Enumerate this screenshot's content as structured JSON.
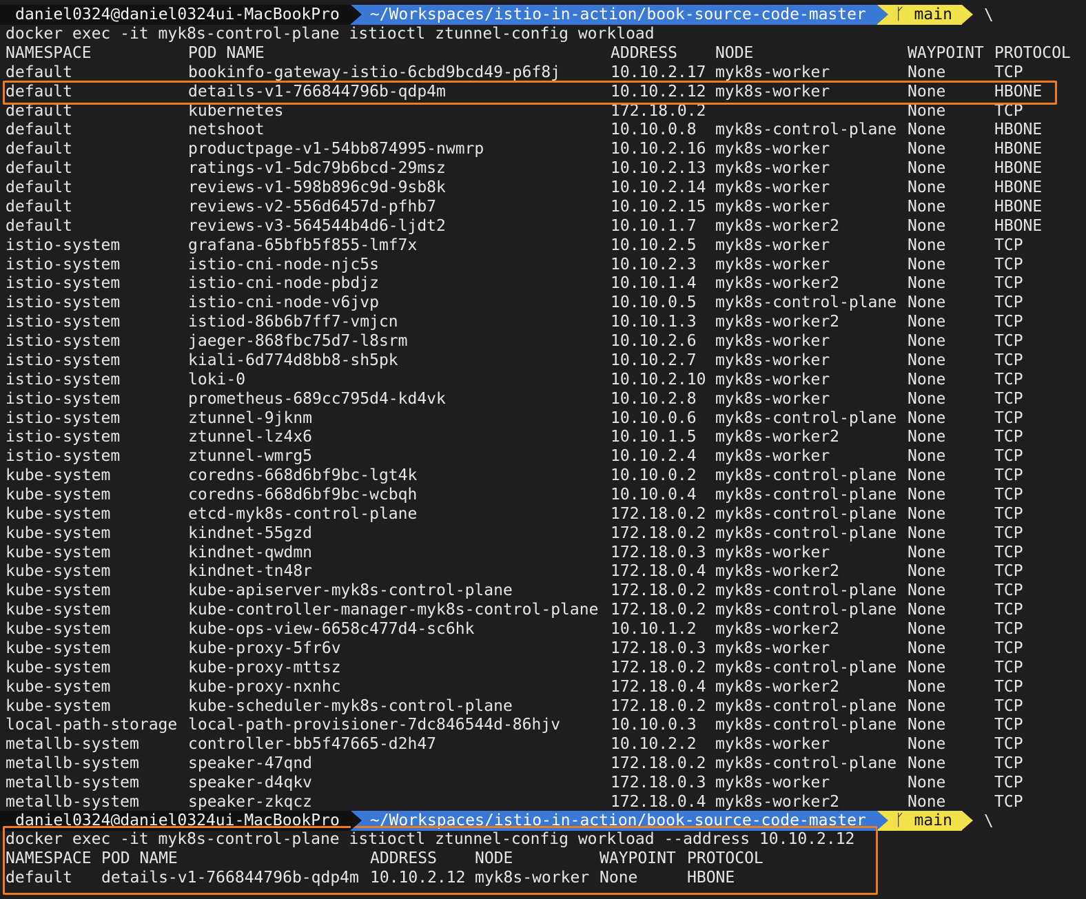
{
  "prompt1": {
    "user": "daniel0324@daniel0324ui-MacBookPro",
    "path": "~/Workspaces/istio-in-action/book-source-code-master",
    "branch_icon": "branch-icon",
    "branch": "main",
    "continuation": "\\"
  },
  "command1": "docker exec -it myk8s-control-plane istioctl ztunnel-config workload",
  "table1": {
    "headers": [
      "NAMESPACE",
      "POD NAME",
      "ADDRESS",
      "NODE",
      "WAYPOINT",
      "PROTOCOL"
    ],
    "rows": [
      [
        "default",
        "bookinfo-gateway-istio-6cbd9bcd49-p6f8j",
        "10.10.2.17",
        "myk8s-worker",
        "None",
        "TCP"
      ],
      [
        "default",
        "details-v1-766844796b-qdp4m",
        "10.10.2.12",
        "myk8s-worker",
        "None",
        "HBONE"
      ],
      [
        "default",
        "kubernetes",
        "172.18.0.2",
        "",
        "None",
        "TCP"
      ],
      [
        "default",
        "netshoot",
        "10.10.0.8",
        "myk8s-control-plane",
        "None",
        "HBONE"
      ],
      [
        "default",
        "productpage-v1-54bb874995-nwmrp",
        "10.10.2.16",
        "myk8s-worker",
        "None",
        "HBONE"
      ],
      [
        "default",
        "ratings-v1-5dc79b6bcd-29msz",
        "10.10.2.13",
        "myk8s-worker",
        "None",
        "HBONE"
      ],
      [
        "default",
        "reviews-v1-598b896c9d-9sb8k",
        "10.10.2.14",
        "myk8s-worker",
        "None",
        "HBONE"
      ],
      [
        "default",
        "reviews-v2-556d6457d-pfhb7",
        "10.10.2.15",
        "myk8s-worker",
        "None",
        "HBONE"
      ],
      [
        "default",
        "reviews-v3-564544b4d6-ljdt2",
        "10.10.1.7",
        "myk8s-worker2",
        "None",
        "HBONE"
      ],
      [
        "istio-system",
        "grafana-65bfb5f855-lmf7x",
        "10.10.2.5",
        "myk8s-worker",
        "None",
        "TCP"
      ],
      [
        "istio-system",
        "istio-cni-node-njc5s",
        "10.10.2.3",
        "myk8s-worker",
        "None",
        "TCP"
      ],
      [
        "istio-system",
        "istio-cni-node-pbdjz",
        "10.10.1.4",
        "myk8s-worker2",
        "None",
        "TCP"
      ],
      [
        "istio-system",
        "istio-cni-node-v6jvp",
        "10.10.0.5",
        "myk8s-control-plane",
        "None",
        "TCP"
      ],
      [
        "istio-system",
        "istiod-86b6b7ff7-vmjcn",
        "10.10.1.3",
        "myk8s-worker2",
        "None",
        "TCP"
      ],
      [
        "istio-system",
        "jaeger-868fbc75d7-l8srm",
        "10.10.2.6",
        "myk8s-worker",
        "None",
        "TCP"
      ],
      [
        "istio-system",
        "kiali-6d774d8bb8-sh5pk",
        "10.10.2.7",
        "myk8s-worker",
        "None",
        "TCP"
      ],
      [
        "istio-system",
        "loki-0",
        "10.10.2.10",
        "myk8s-worker",
        "None",
        "TCP"
      ],
      [
        "istio-system",
        "prometheus-689cc795d4-kd4vk",
        "10.10.2.8",
        "myk8s-worker",
        "None",
        "TCP"
      ],
      [
        "istio-system",
        "ztunnel-9jknm",
        "10.10.0.6",
        "myk8s-control-plane",
        "None",
        "TCP"
      ],
      [
        "istio-system",
        "ztunnel-lz4x6",
        "10.10.1.5",
        "myk8s-worker2",
        "None",
        "TCP"
      ],
      [
        "istio-system",
        "ztunnel-wmrg5",
        "10.10.2.4",
        "myk8s-worker",
        "None",
        "TCP"
      ],
      [
        "kube-system",
        "coredns-668d6bf9bc-lgt4k",
        "10.10.0.2",
        "myk8s-control-plane",
        "None",
        "TCP"
      ],
      [
        "kube-system",
        "coredns-668d6bf9bc-wcbqh",
        "10.10.0.4",
        "myk8s-control-plane",
        "None",
        "TCP"
      ],
      [
        "kube-system",
        "etcd-myk8s-control-plane",
        "172.18.0.2",
        "myk8s-control-plane",
        "None",
        "TCP"
      ],
      [
        "kube-system",
        "kindnet-55gzd",
        "172.18.0.2",
        "myk8s-control-plane",
        "None",
        "TCP"
      ],
      [
        "kube-system",
        "kindnet-qwdmn",
        "172.18.0.3",
        "myk8s-worker",
        "None",
        "TCP"
      ],
      [
        "kube-system",
        "kindnet-tn48r",
        "172.18.0.4",
        "myk8s-worker2",
        "None",
        "TCP"
      ],
      [
        "kube-system",
        "kube-apiserver-myk8s-control-plane",
        "172.18.0.2",
        "myk8s-control-plane",
        "None",
        "TCP"
      ],
      [
        "kube-system",
        "kube-controller-manager-myk8s-control-plane",
        "172.18.0.2",
        "myk8s-control-plane",
        "None",
        "TCP"
      ],
      [
        "kube-system",
        "kube-ops-view-6658c477d4-sc6hk",
        "10.10.1.2",
        "myk8s-worker2",
        "None",
        "TCP"
      ],
      [
        "kube-system",
        "kube-proxy-5fr6v",
        "172.18.0.3",
        "myk8s-worker",
        "None",
        "TCP"
      ],
      [
        "kube-system",
        "kube-proxy-mttsz",
        "172.18.0.2",
        "myk8s-control-plane",
        "None",
        "TCP"
      ],
      [
        "kube-system",
        "kube-proxy-nxnhc",
        "172.18.0.4",
        "myk8s-worker2",
        "None",
        "TCP"
      ],
      [
        "kube-system",
        "kube-scheduler-myk8s-control-plane",
        "172.18.0.2",
        "myk8s-control-plane",
        "None",
        "TCP"
      ],
      [
        "local-path-storage",
        "local-path-provisioner-7dc846544d-86hjv",
        "10.10.0.3",
        "myk8s-control-plane",
        "None",
        "TCP"
      ],
      [
        "metallb-system",
        "controller-bb5f47665-d2h47",
        "10.10.2.2",
        "myk8s-worker",
        "None",
        "TCP"
      ],
      [
        "metallb-system",
        "speaker-47qnd",
        "172.18.0.2",
        "myk8s-control-plane",
        "None",
        "TCP"
      ],
      [
        "metallb-system",
        "speaker-d4qkv",
        "172.18.0.3",
        "myk8s-worker",
        "None",
        "TCP"
      ],
      [
        "metallb-system",
        "speaker-zkqcz",
        "172.18.0.4",
        "myk8s-worker2",
        "None",
        "TCP"
      ]
    ]
  },
  "prompt2": {
    "user": "daniel0324@daniel0324ui-MacBookPro",
    "path": "~/Workspaces/istio-in-action/book-source-code-master",
    "branch_icon": "branch-icon",
    "branch": "main",
    "continuation": "\\"
  },
  "command2": "docker exec -it myk8s-control-plane istioctl ztunnel-config workload --address 10.10.2.12",
  "table2": {
    "headers": [
      "NAMESPACE",
      "POD NAME",
      "ADDRESS",
      "NODE",
      "WAYPOINT",
      "PROTOCOL"
    ],
    "rows": [
      [
        "default",
        "details-v1-766844796b-qdp4m",
        "10.10.2.12",
        "myk8s-worker",
        "None",
        "HBONE"
      ]
    ]
  },
  "colors": {
    "background": "#1e1e1e",
    "text": "#e6e6e6",
    "highlight": "#f07a1a",
    "path_segment": "#3a78d6",
    "git_segment": "#f2e24a",
    "user_segment": "#111111"
  }
}
